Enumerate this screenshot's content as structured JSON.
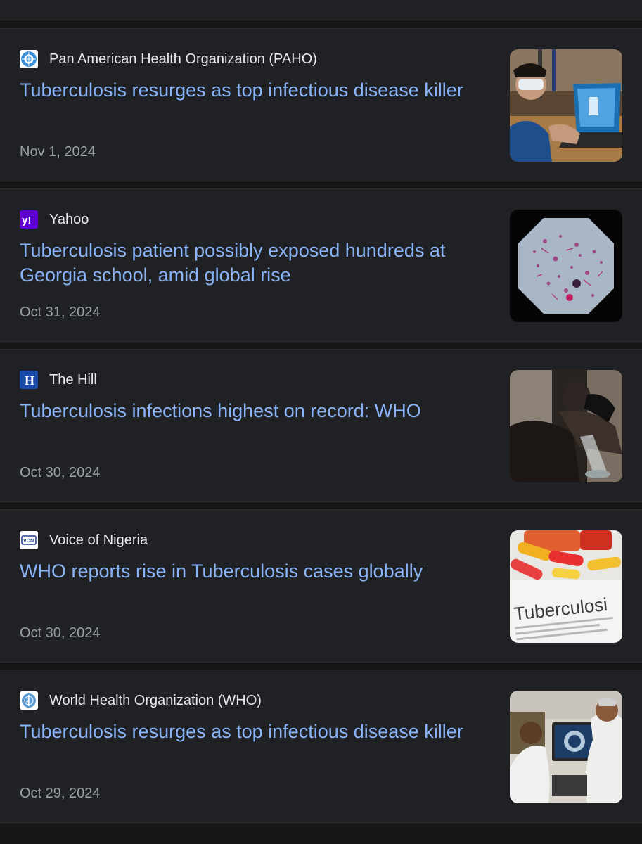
{
  "articles": [
    {
      "source": "Pan American Health Organization (PAHO)",
      "source_icon": "globe-laurel-icon",
      "headline": "Tuberculosis resurges as top infectious disease killer",
      "date": "Nov 1, 2024"
    },
    {
      "source": "Yahoo",
      "source_icon": "yahoo-logo-icon",
      "headline": "Tuberculosis patient possibly exposed hundreds at Georgia school, amid global rise",
      "date": "Oct 31, 2024"
    },
    {
      "source": "The Hill",
      "source_icon": "the-hill-logo-icon",
      "headline": "Tuberculosis infections highest on record: WHO",
      "date": "Oct 30, 2024"
    },
    {
      "source": "Voice of Nigeria",
      "source_icon": "von-logo-icon",
      "headline": "WHO reports rise in Tuberculosis cases globally",
      "date": "Oct 30, 2024"
    },
    {
      "source": "World Health Organization (WHO)",
      "source_icon": "who-emblem-icon",
      "headline": "Tuberculosis resurges as top infectious disease killer",
      "date": "Oct 29, 2024"
    }
  ],
  "colors": {
    "background": "#161616",
    "card": "#202124",
    "headline": "#8ab4f8",
    "source": "#e8eaed",
    "date": "#9aa0a6"
  }
}
